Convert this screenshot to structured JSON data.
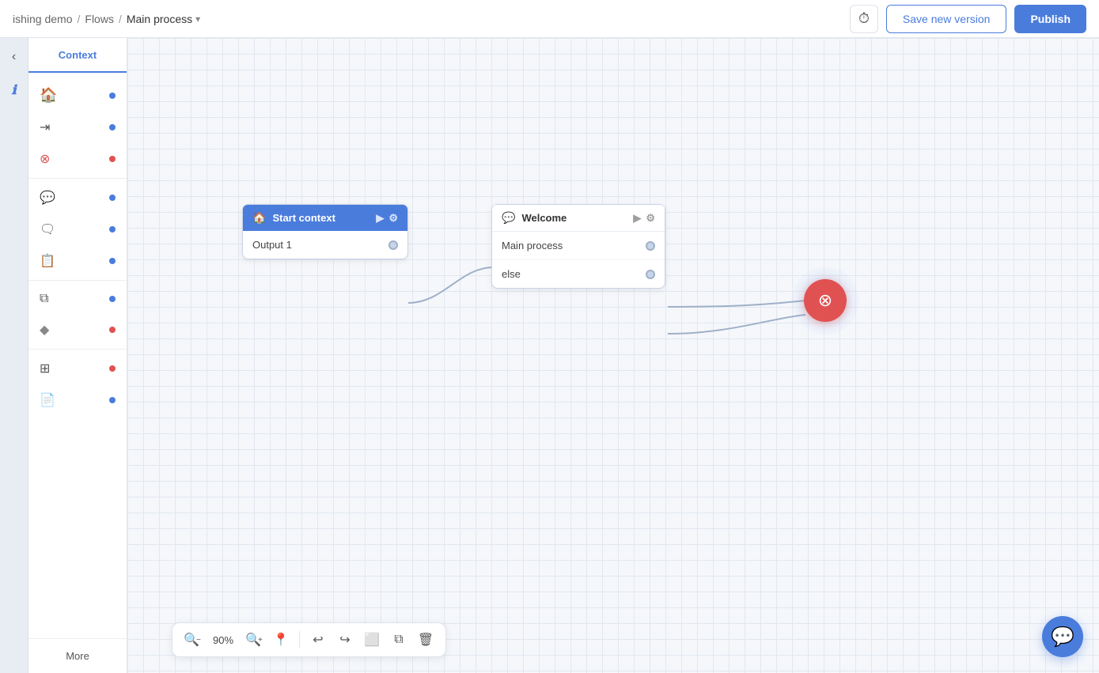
{
  "header": {
    "breadcrumb": {
      "app": "ishing demo",
      "sep1": "/",
      "section": "Flows",
      "sep2": "/",
      "current": "Main process",
      "chevron": "▾"
    },
    "history_icon": "⏱",
    "save_label": "Save new version",
    "publish_label": "Publish"
  },
  "sidebar": {
    "tab_label": "Context",
    "items": [
      {
        "icon": "🏠",
        "dot_color": "blue"
      },
      {
        "icon": "⬅",
        "dot_color": "blue"
      },
      {
        "icon": "✕",
        "dot_color": "red"
      },
      {
        "icon": "💬",
        "dot_color": "blue"
      },
      {
        "icon": "💬",
        "dot_color": "blue",
        "style": "dots"
      },
      {
        "icon": "📋",
        "dot_color": "blue"
      },
      {
        "icon": "📂",
        "dot_color": "blue"
      },
      {
        "icon": "◆",
        "dot_color": "blue"
      },
      {
        "icon": "⊞",
        "dot_color": "blue"
      },
      {
        "icon": "📄",
        "dot_color": "blue"
      }
    ],
    "more_label": "More"
  },
  "nodes": {
    "start": {
      "title": "Start context",
      "icon": "🏠",
      "outputs": [
        {
          "label": "Output 1"
        }
      ]
    },
    "welcome": {
      "title": "Welcome",
      "icon": "💬",
      "outputs": [
        {
          "label": "Main process"
        },
        {
          "label": "else"
        }
      ]
    }
  },
  "toolbar": {
    "zoom_out_icon": "🔍-",
    "zoom_value": "90%",
    "zoom_in_icon": "🔍+",
    "locate_icon": "📍",
    "undo_icon": "↩",
    "redo_icon": "↪",
    "frame_icon": "⬜",
    "copy_icon": "📋",
    "delete_icon": "🗑"
  },
  "colors": {
    "blue": "#4a7cdc",
    "red": "#e05252",
    "blue_dot": "#4a7cdc",
    "red_dot": "#e05252"
  }
}
